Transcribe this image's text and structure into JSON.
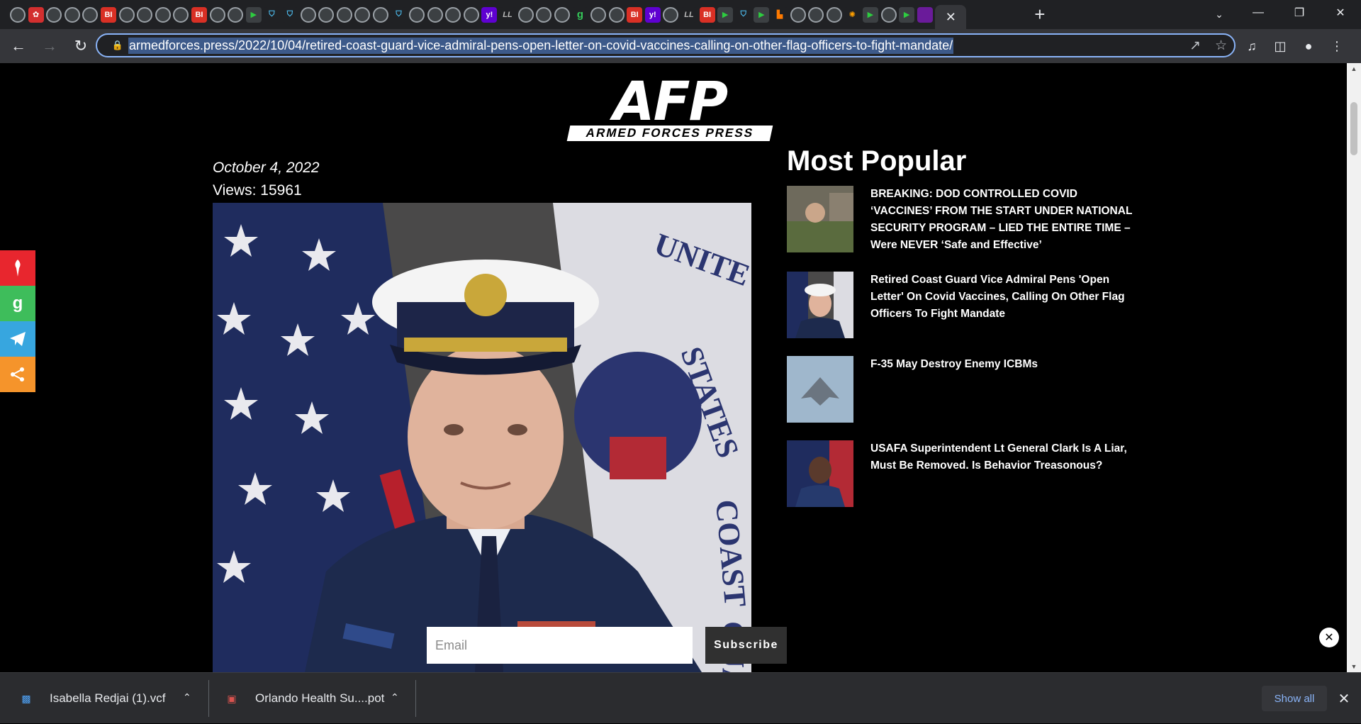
{
  "browser": {
    "tab_icons": [
      "globe",
      "red",
      "globe",
      "globe",
      "globe",
      "bi",
      "globe",
      "globe",
      "globe",
      "globe",
      "bi",
      "globe",
      "globe",
      "play",
      "shield",
      "shield",
      "globe",
      "globe",
      "globe",
      "globe",
      "globe",
      "shield",
      "globe",
      "globe",
      "globe",
      "globe",
      "yahoo",
      "ll",
      "globe",
      "globe",
      "globe",
      "gettr",
      "globe",
      "globe",
      "bi",
      "yahoo",
      "globe",
      "ll",
      "bi",
      "play",
      "shield",
      "play",
      "orange",
      "globe",
      "globe",
      "globe",
      "sun",
      "play",
      "globe",
      "play",
      "purple"
    ],
    "bi_label": "BI",
    "gettr_label": "g",
    "yahoo_label": "y!",
    "ll_label": "LL",
    "active_tab_close": "✕",
    "new_tab": "+",
    "url": "armedforces.press/2022/10/04/retired-coast-guard-vice-admiral-pens-open-letter-on-covid-vaccines-calling-on-other-flag-officers-to-fight-mandate/"
  },
  "site": {
    "logo_main": "AFP",
    "logo_sub": "ARMED FORCES PRESS"
  },
  "article": {
    "date": "October 4, 2022",
    "views": "Views: 15961"
  },
  "sidebar": {
    "title": "Most Popular",
    "items": [
      {
        "title": "BREAKING: DOD CONTROLLED COVID ‘VACCINES’ FROM THE START UNDER NATIONAL SECURITY PROGRAM – LIED THE ENTIRE TIME – Were NEVER ‘Safe and Effective’"
      },
      {
        "title": "Retired Coast Guard Vice Admiral Pens 'Open Letter' On Covid Vaccines, Calling On Other Flag Officers To Fight Mandate"
      },
      {
        "title": "F-35 May Destroy Enemy ICBMs"
      },
      {
        "title": "USAFA Superintendent Lt General Clark Is A Liar, Must Be Removed. Is Behavior Treasonous?"
      }
    ]
  },
  "share": {
    "gettr": "g"
  },
  "subscribe": {
    "placeholder": "Email",
    "button": "Subscribe"
  },
  "downloads": {
    "items": [
      {
        "name": "Isabella Redjai (1).vcf"
      },
      {
        "name": "Orlando Health Su....pot"
      }
    ],
    "show_all": "Show all"
  },
  "colors": {
    "accent_blue": "#8ab4f8",
    "share_red": "#e8262e",
    "share_green": "#3ebd5b",
    "share_telegram": "#37a6df",
    "share_orange": "#f5942b"
  }
}
